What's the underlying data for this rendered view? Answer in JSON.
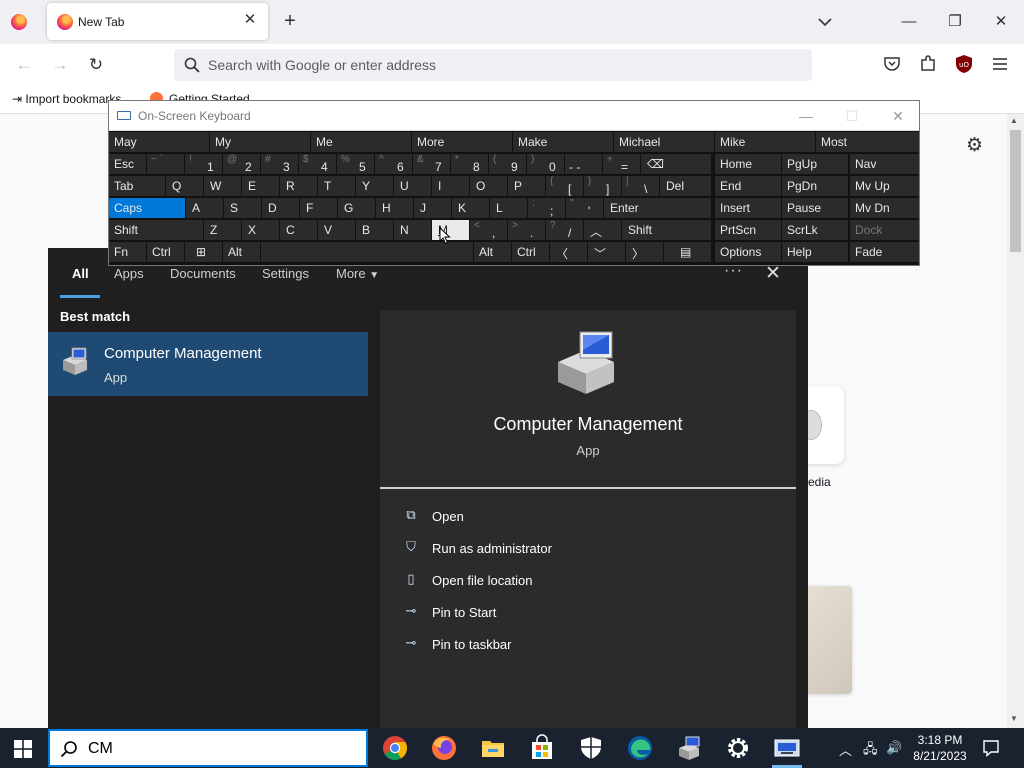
{
  "browser": {
    "tab_title": "New Tab",
    "url_placeholder": "Search with Google or enter address",
    "bookmarks": [
      "Import bookmarks",
      "Getting Started"
    ]
  },
  "newtab": {
    "tile_caption": "edia"
  },
  "osk": {
    "title": "On-Screen Keyboard",
    "predictions": [
      "May",
      "My",
      "Me",
      "More",
      "Make",
      "Michael",
      "Mike",
      "Most"
    ],
    "row1": [
      {
        "sym": "~ `",
        "main": ""
      },
      {
        "sym": "!",
        "main": "1"
      },
      {
        "sym": "@",
        "main": "2"
      },
      {
        "sym": "#",
        "main": "3"
      },
      {
        "sym": "$",
        "main": "4"
      },
      {
        "sym": "%",
        "main": "5"
      },
      {
        "sym": "^",
        "main": "6"
      },
      {
        "sym": "&",
        "main": "7"
      },
      {
        "sym": "*",
        "main": "8"
      },
      {
        "sym": "(",
        "main": "9"
      },
      {
        "sym": ")",
        "main": "0"
      },
      {
        "sym": "",
        "main": "- -"
      },
      {
        "sym": "+",
        "main": "="
      }
    ],
    "esc": "Esc",
    "tab": "Tab",
    "caps": "Caps",
    "shift": "Shift",
    "fn": "Fn",
    "ctrl": "Ctrl",
    "alt": "Alt",
    "del": "Del",
    "enter": "Enter",
    "row2_letters": [
      "Q",
      "W",
      "E",
      "R",
      "T",
      "Y",
      "U",
      "I",
      "O",
      "P"
    ],
    "row2_brackets": [
      {
        "sym": "{",
        "main": "["
      },
      {
        "sym": "}",
        "main": "]"
      },
      {
        "sym": "|",
        "main": "\\"
      }
    ],
    "row3_letters": [
      "A",
      "S",
      "D",
      "F",
      "G",
      "H",
      "J",
      "K",
      "L"
    ],
    "row3_punct": [
      {
        "sym": ":",
        "main": ";"
      },
      {
        "sym": "\"",
        "main": "'"
      }
    ],
    "row4_letters": [
      "Z",
      "X",
      "C",
      "V",
      "B",
      "N",
      "M"
    ],
    "row4_punct": [
      {
        "sym": "<",
        "main": ","
      },
      {
        "sym": ">",
        "main": "."
      },
      {
        "sym": "?",
        "main": "/"
      }
    ],
    "nav_keys": [
      [
        "Home",
        "PgUp",
        "Nav"
      ],
      [
        "End",
        "PgDn",
        "Mv Up"
      ],
      [
        "Insert",
        "Pause",
        "Mv Dn"
      ],
      [
        "PrtScn",
        "ScrLk",
        "Dock"
      ],
      [
        "Options",
        "Help",
        "Fade"
      ]
    ]
  },
  "search": {
    "tabs": [
      "All",
      "Apps",
      "Documents",
      "Settings",
      "More"
    ],
    "best_match_label": "Best match",
    "result": {
      "name": "Computer Management",
      "type": "App"
    },
    "actions": [
      "Open",
      "Run as administrator",
      "Open file location",
      "Pin to Start",
      "Pin to taskbar"
    ],
    "query": "CM"
  },
  "taskbar": {
    "time": "3:18 PM",
    "date": "8/21/2023"
  },
  "colors": {
    "accent": "#0078d7",
    "selected_result": "#1e4a73",
    "taskbar": "#1a2230"
  }
}
